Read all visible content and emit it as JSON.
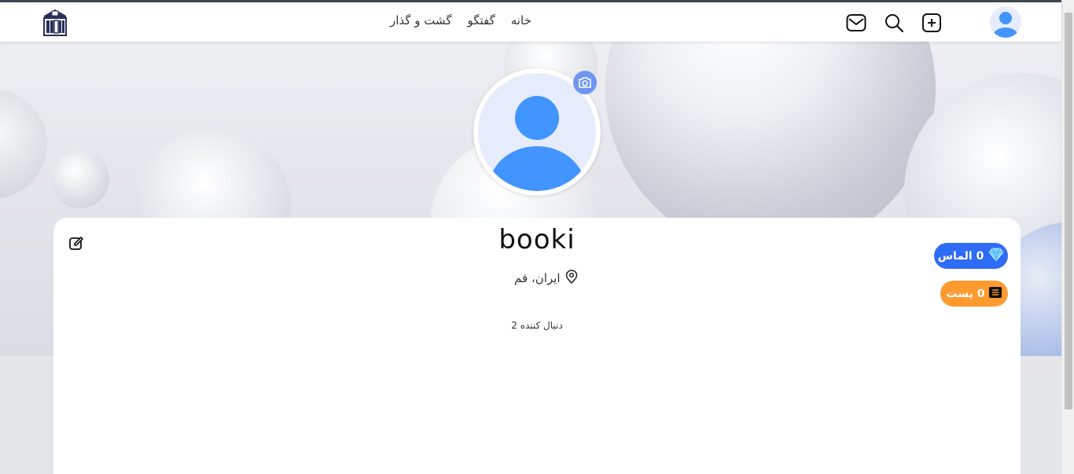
{
  "nav": {
    "links": [
      "خانه",
      "گفتگو",
      "گشت و گذار"
    ],
    "icons": [
      "mail-icon",
      "search-icon",
      "add-post-icon",
      "user-avatar"
    ]
  },
  "profile": {
    "username": "booki",
    "location": "ایران، قم",
    "followers": "2 دنبال کننده",
    "diamonds_label": "0 الماس",
    "posts_label": "0 پست"
  },
  "colors": {
    "accent_blue": "#2f6cf5",
    "accent_orange": "#ff9a2f",
    "avatar_blue": "#4294ff",
    "camera_blue": "#6f95f2"
  }
}
